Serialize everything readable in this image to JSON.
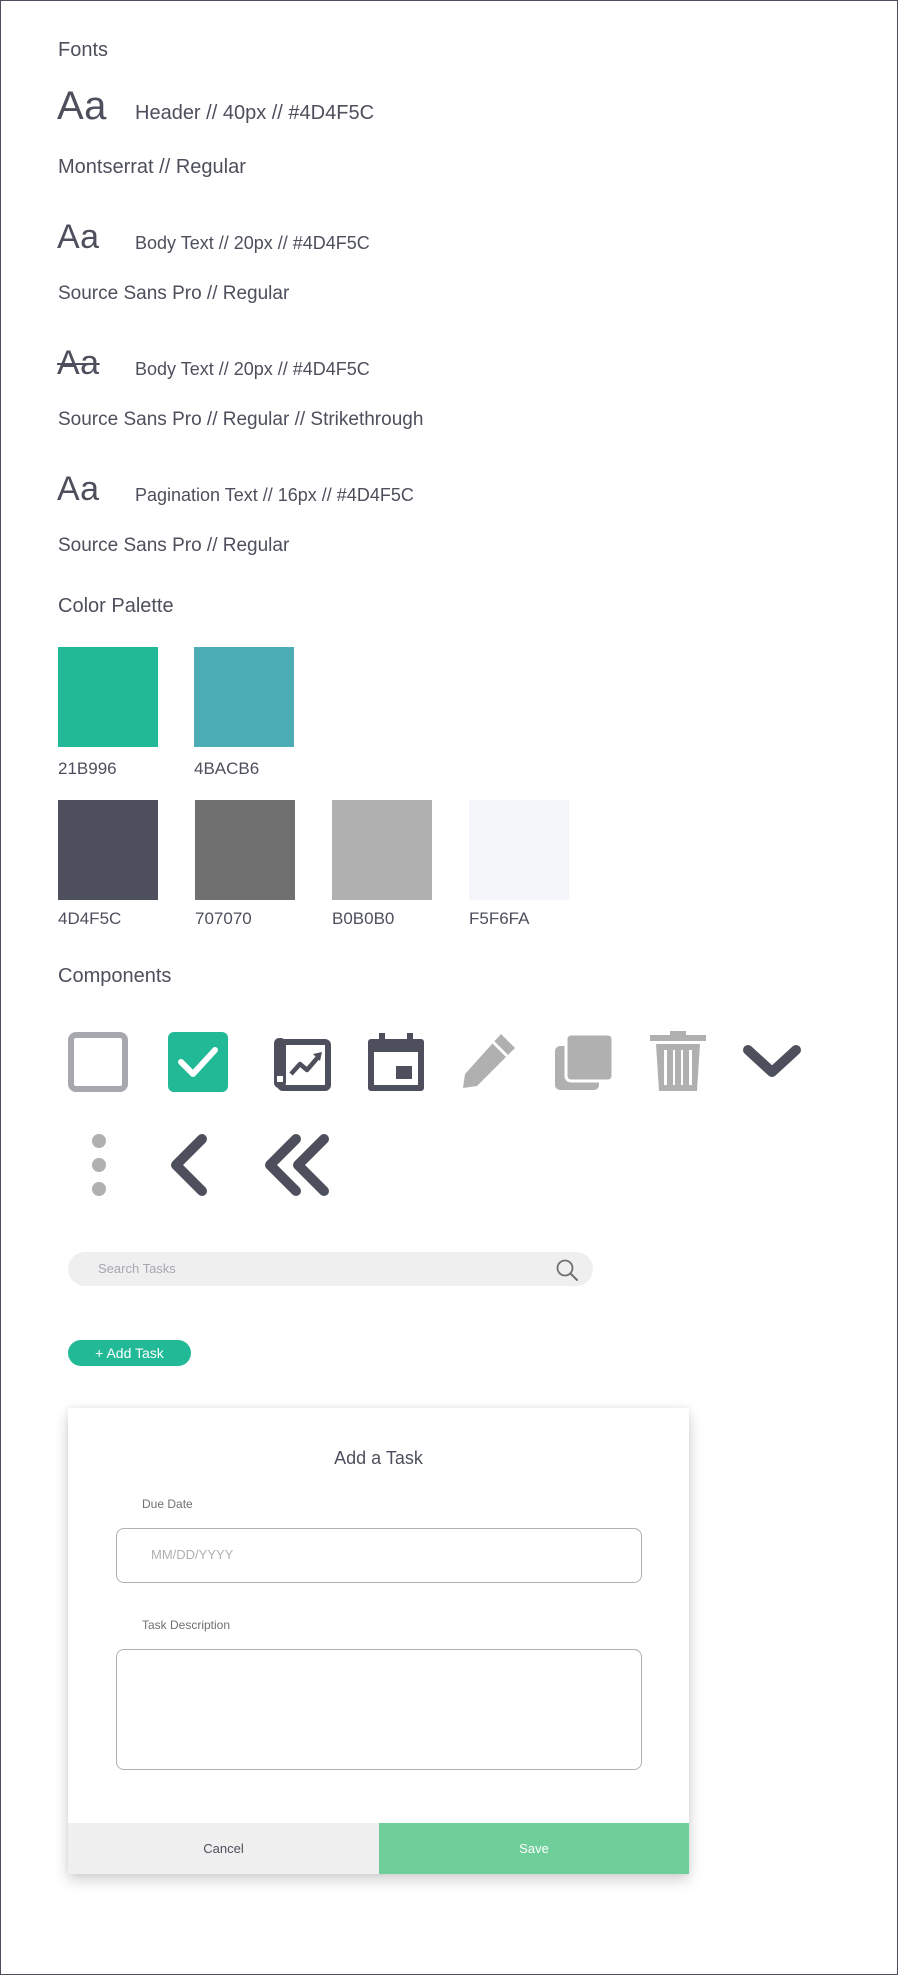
{
  "fonts": {
    "title": "Fonts",
    "header": {
      "sample": "Aa",
      "spec": "Header // 40px // #4D4F5C",
      "family": "Montserrat // Regular"
    },
    "body": {
      "sample": "Aa",
      "spec": "Body Text // 20px // #4D4F5C",
      "family": "Source Sans Pro // Regular"
    },
    "strike": {
      "sample": "Aa",
      "spec": "Body Text // 20px // #4D4F5C",
      "family": "Source Sans Pro // Regular // Strikethrough"
    },
    "pagination": {
      "sample": "Aa",
      "spec": "Pagination Text // 16px // #4D4F5C",
      "family": "Source Sans Pro // Regular"
    }
  },
  "palette": {
    "title": "Color Palette",
    "row1": [
      {
        "label": "21B996",
        "color": "#21B996"
      },
      {
        "label": "4BACB6",
        "color": "#4BACB6"
      }
    ],
    "row2": [
      {
        "label": "4D4F5C",
        "color": "#4D4F5C"
      },
      {
        "label": "707070",
        "color": "#707070"
      },
      {
        "label": "B0B0B0",
        "color": "#B0B0B0"
      },
      {
        "label": "F5F6FA",
        "color": "#F5F6FA"
      }
    ]
  },
  "components": {
    "title": "Components",
    "icons": [
      "checkbox-empty-icon",
      "checkbox-checked-icon",
      "project-chart-icon",
      "calendar-icon",
      "pencil-icon",
      "copy-icon",
      "trash-icon",
      "chevron-down-icon",
      "kebab-menu-icon",
      "chevron-left-icon",
      "double-chevron-left-icon"
    ],
    "search": {
      "placeholder": "Search Tasks"
    },
    "add_button": "+ Add Task"
  },
  "modal": {
    "title": "Add a Task",
    "due_date_label": "Due Date",
    "due_date_placeholder": "MM/DD/YYYY",
    "description_label": "Task Description",
    "description_value": "",
    "cancel": "Cancel",
    "save": "Save"
  },
  "colors": {
    "text": "#4D4F5C",
    "accent": "#21B996",
    "teal": "#4BACB6",
    "gray": "#707070",
    "light_gray": "#B0B0B0",
    "bg_light": "#F5F6FA",
    "save_green": "#6FCF9B"
  }
}
